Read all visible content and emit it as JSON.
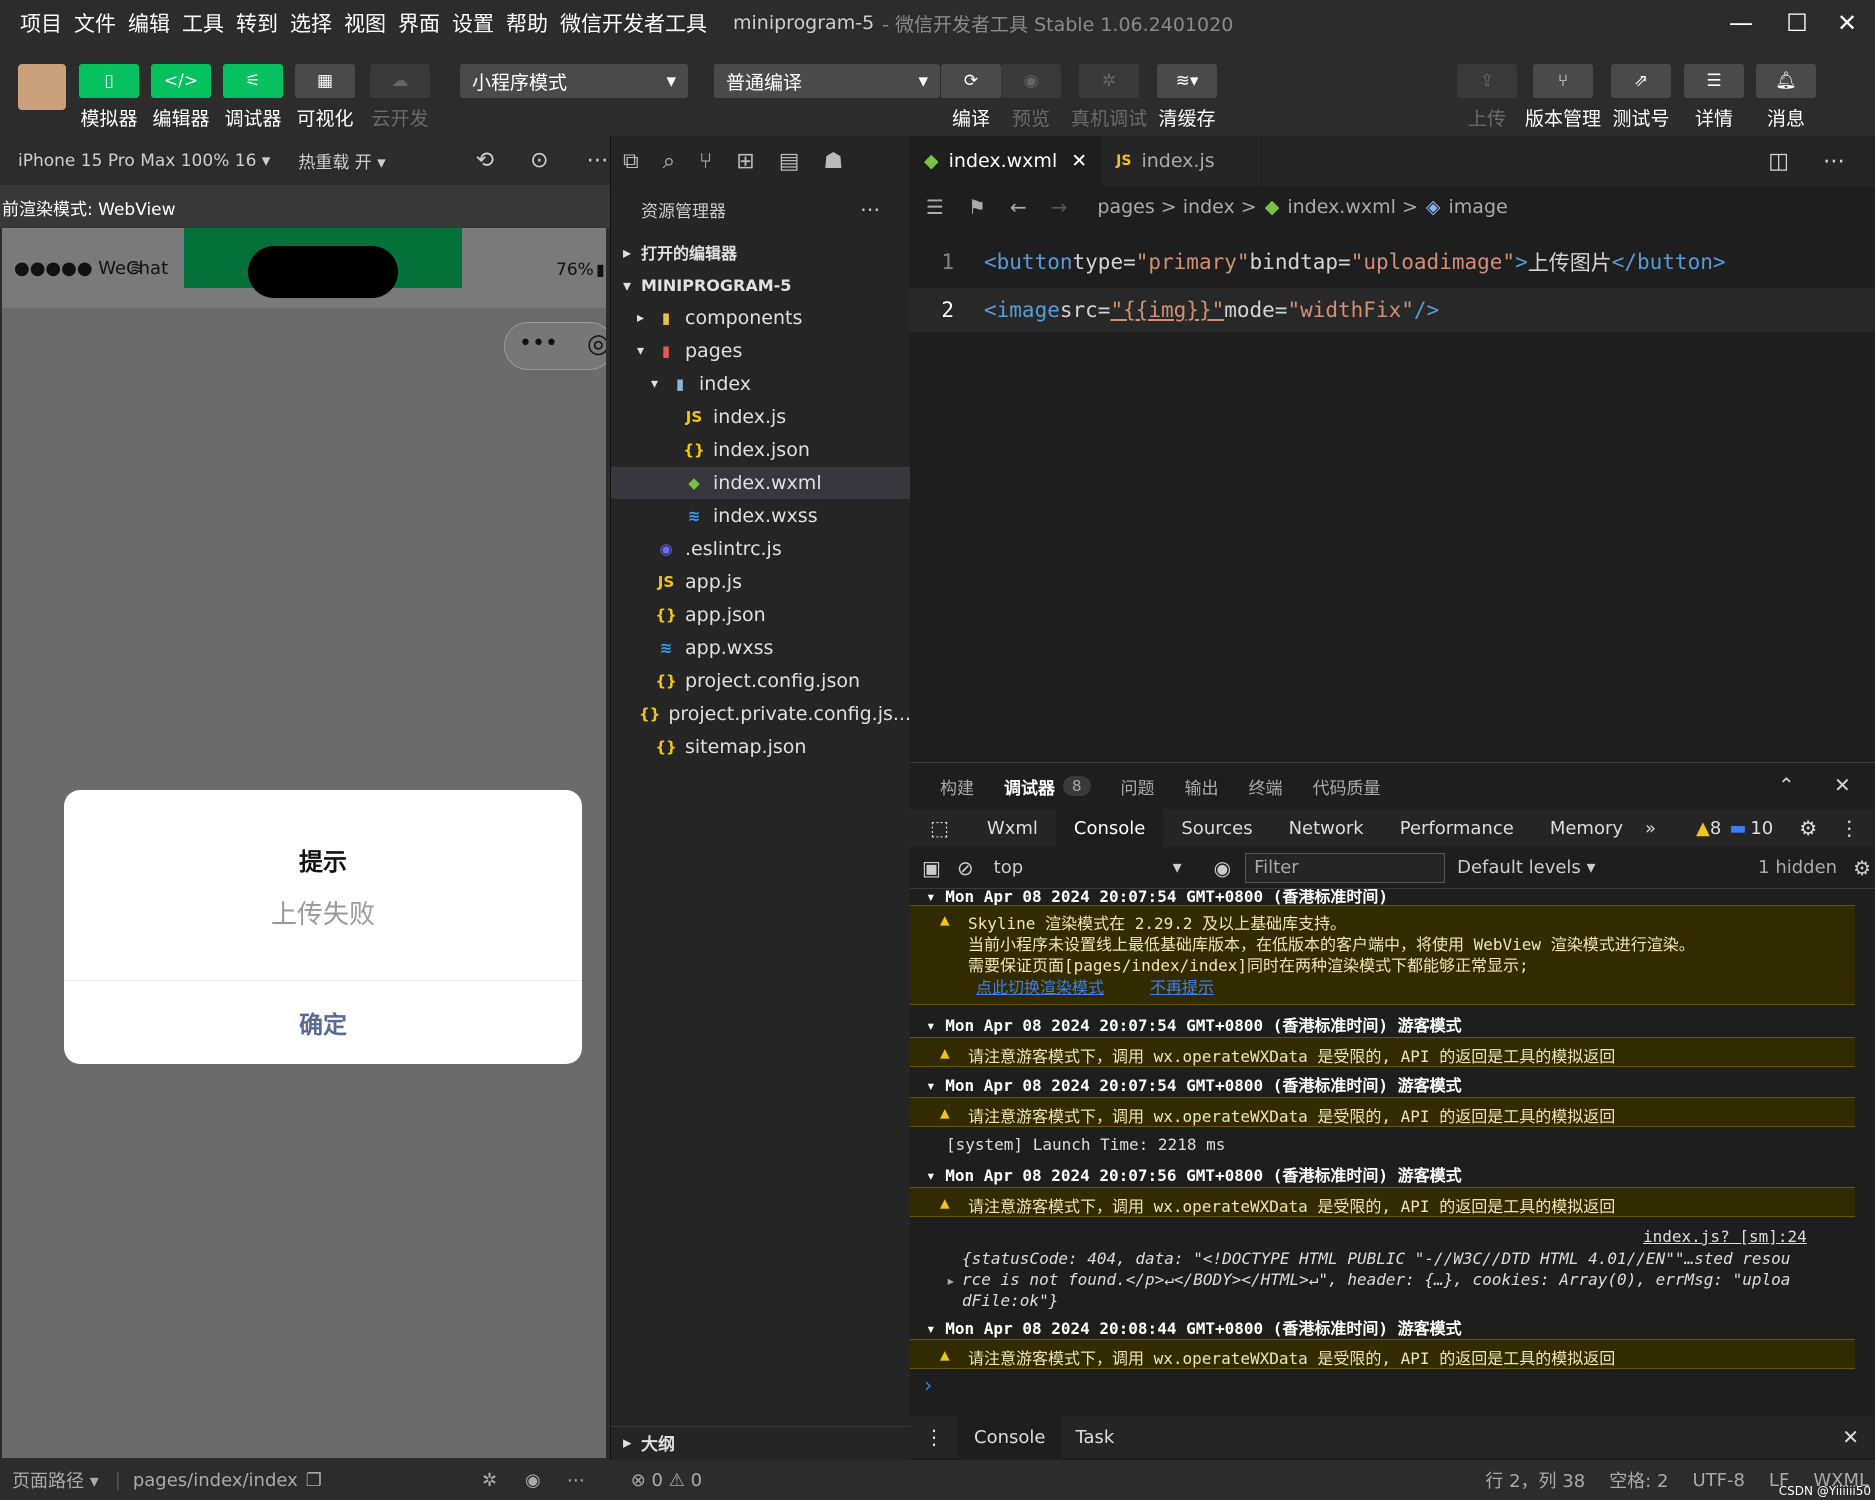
{
  "menu": {
    "items": [
      "项目",
      "文件",
      "编辑",
      "工具",
      "转到",
      "选择",
      "视图",
      "界面",
      "设置",
      "帮助",
      "微信开发者工具"
    ],
    "project": "miniprogram-5",
    "app_title": "- 微信开发者工具 Stable 1.06.2401020",
    "min": "—",
    "max": "☐",
    "close": "✕"
  },
  "toolbar": {
    "simulator": "模拟器",
    "editor": "编辑器",
    "debugger": "调试器",
    "visual": "可视化",
    "cloud": "云开发",
    "mode": "小程序模式",
    "compile_mode": "普通编译",
    "compile": "编译",
    "preview": "预览",
    "remote_debug": "真机调试",
    "clear_cache": "清缓存",
    "upload": "上传",
    "version": "版本管理",
    "test": "测试号",
    "details": "详情",
    "messages": "消息"
  },
  "sim": {
    "device": "iPhone 15 Pro Max 100% 16 ▾",
    "hot_reload": "热重载 开 ▾",
    "render_mode": "前渲染模式: WebView",
    "carrier": "●●●●● WeChat",
    "battery": "76%",
    "dialog_title": "提示",
    "dialog_content": "上传失败",
    "dialog_confirm": "确定"
  },
  "explorer": {
    "title": "资源管理器",
    "open_editors": "打开的编辑器",
    "project": "MINIPROGRAM-5",
    "outline": "大纲",
    "tree": [
      {
        "label": "components",
        "icon": "folder-icon",
        "glyph": "▮",
        "color": "#e8c04a",
        "depth": 1,
        "arrow": "▸"
      },
      {
        "label": "pages",
        "icon": "folder-icon",
        "glyph": "▮",
        "color": "#e05a4a",
        "depth": 1,
        "arrow": "▾"
      },
      {
        "label": "index",
        "icon": "folder-icon",
        "glyph": "▮",
        "color": "#8ab4d4",
        "depth": 2,
        "arrow": "▾"
      },
      {
        "label": "index.js",
        "icon": "js-file-icon",
        "glyph": "JS",
        "color": "#f0c419",
        "depth": 3,
        "arrow": ""
      },
      {
        "label": "index.json",
        "icon": "json-file-icon",
        "glyph": "{}",
        "color": "#f0c419",
        "depth": 3,
        "arrow": ""
      },
      {
        "label": "index.wxml",
        "icon": "wxml-file-icon",
        "glyph": "◆",
        "color": "#7ac143",
        "depth": 3,
        "arrow": ""
      },
      {
        "label": "index.wxss",
        "icon": "wxss-file-icon",
        "glyph": "≋",
        "color": "#3a9ff5",
        "depth": 3,
        "arrow": ""
      },
      {
        "label": ".eslintrc.js",
        "icon": "eslint-file-icon",
        "glyph": "◉",
        "color": "#6b6bff",
        "depth": 1,
        "arrow": ""
      },
      {
        "label": "app.js",
        "icon": "js-file-icon",
        "glyph": "JS",
        "color": "#f0c419",
        "depth": 1,
        "arrow": ""
      },
      {
        "label": "app.json",
        "icon": "json-file-icon",
        "glyph": "{}",
        "color": "#f0c419",
        "depth": 1,
        "arrow": ""
      },
      {
        "label": "app.wxss",
        "icon": "wxss-file-icon",
        "glyph": "≋",
        "color": "#3a9ff5",
        "depth": 1,
        "arrow": ""
      },
      {
        "label": "project.config.json",
        "icon": "json-file-icon",
        "glyph": "{}",
        "color": "#f0c419",
        "depth": 1,
        "arrow": ""
      },
      {
        "label": "project.private.config.js...",
        "icon": "json-file-icon",
        "glyph": "{}",
        "color": "#f0c419",
        "depth": 1,
        "arrow": ""
      },
      {
        "label": "sitemap.json",
        "icon": "json-file-icon",
        "glyph": "{}",
        "color": "#f0c419",
        "depth": 1,
        "arrow": ""
      }
    ]
  },
  "editor": {
    "tab1": "index.wxml",
    "tab2": "index.js",
    "crumbs": "pages > index >",
    "crumb_file": "index.wxml >",
    "crumb_elem": "image",
    "line1": {
      "n": "1",
      "open": "<button",
      "a1": " type=",
      "v1": "\"primary\"",
      "a2": "bindtap=",
      "v2": "\"uploadimage\"",
      "close": ">",
      "text": "上传图片",
      "end": "</button>"
    },
    "line2": {
      "n": "2",
      "open": "<image",
      "a1": " src=",
      "v1": "\"{{img}}\"",
      "a2": "mode=",
      "v2": "\"widthFix\"",
      "close": "/>"
    }
  },
  "panel": {
    "tabs": [
      "构建",
      "调试器",
      "问题",
      "输出",
      "终端",
      "代码质量"
    ],
    "badge": "8",
    "devtabs": [
      "Wxml",
      "Console",
      "Sources",
      "Network",
      "Performance",
      "Memory"
    ],
    "more": "»",
    "warn_count": "8",
    "info_count": "10",
    "context": "top",
    "filter": "Filter",
    "levels": "Default levels ▾",
    "hidden": "1 hidden",
    "logs": {
      "h0": "▾ Mon Apr 08 2024 20:07:54 GMT+0800 (香港标准时间)",
      "w0a": "Skyline 渲染模式在 2.29.2 及以上基础库支持。",
      "w0b": "当前小程序未设置线上最低基础库版本，在低版本的客户端中，将使用 WebView 渲染模式进行渲染。",
      "w0c": "需要保证页面[pages/index/index]同时在两种渲染模式下都能够正常显示;",
      "w0l1": "点此切换渲染模式",
      "w0l2": "不再提示",
      "h1": "▾ Mon Apr 08 2024 20:07:54 GMT+0800 (香港标准时间) 游客模式",
      "w1": "请注意游客模式下，调用 wx.operateWXData 是受限的, API 的返回是工具的模拟返回",
      "h2": "▾ Mon Apr 08 2024 20:07:54 GMT+0800 (香港标准时间) 游客模式",
      "w2": "请注意游客模式下，调用 wx.operateWXData 是受限的, API 的返回是工具的模拟返回",
      "sys": "[system] Launch Time: 2218 ms",
      "h3": "▾ Mon Apr 08 2024 20:07:56 GMT+0800 (香港标准时间) 游客模式",
      "w3": "请注意游客模式下，调用 wx.operateWXData 是受限的, API 的返回是工具的模拟返回",
      "src": "index.js? [sm]:24",
      "o1": "{statusCode: 404, data: \"<!DOCTYPE HTML PUBLIC \"-//W3C//DTD HTML 4.01//EN\"\"…sted resou",
      "o2": "rce is not found.</p>↵</BODY></HTML>↵\", header: {…}, cookies: Array(0), errMsg: \"uploa",
      "o3": "dFile:ok\"}",
      "h4": "▾ Mon Apr 08 2024 20:08:44 GMT+0800 (香港标准时间) 游客模式",
      "w4": "请注意游客模式下，调用 wx.operateWXData 是受限的, API 的返回是工具的模拟返回",
      "prompt": "›"
    }
  },
  "drawer": {
    "console": "Console",
    "task": "Task"
  },
  "status": {
    "route_label": "页面路径 ▾",
    "route": "pages/index/index",
    "errors": "⊗ 0 ⚠ 0",
    "pos": "行 2，列 38",
    "spaces": "空格: 2",
    "enc": "UTF-8",
    "eol": "LF",
    "lang": "WXML",
    "wm": "CSDN @Yiiiiii50"
  }
}
